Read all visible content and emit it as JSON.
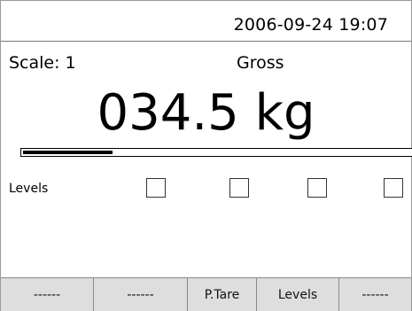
{
  "header": {
    "datetime": "2006-09-24  19:07"
  },
  "status": {
    "scale": "Scale: 1",
    "mode": "Gross"
  },
  "weight": {
    "display": "034.5 kg"
  },
  "range_bar": {
    "fill_fraction": 0.23
  },
  "levels": {
    "label": "Levels",
    "indicators": [
      {
        "checked": false
      },
      {
        "checked": false
      },
      {
        "checked": false
      },
      {
        "checked": false
      }
    ]
  },
  "softkeys": [
    {
      "label": "------"
    },
    {
      "label": "------"
    },
    {
      "label": "P.Tare"
    },
    {
      "label": "Levels"
    },
    {
      "label": "------"
    }
  ]
}
